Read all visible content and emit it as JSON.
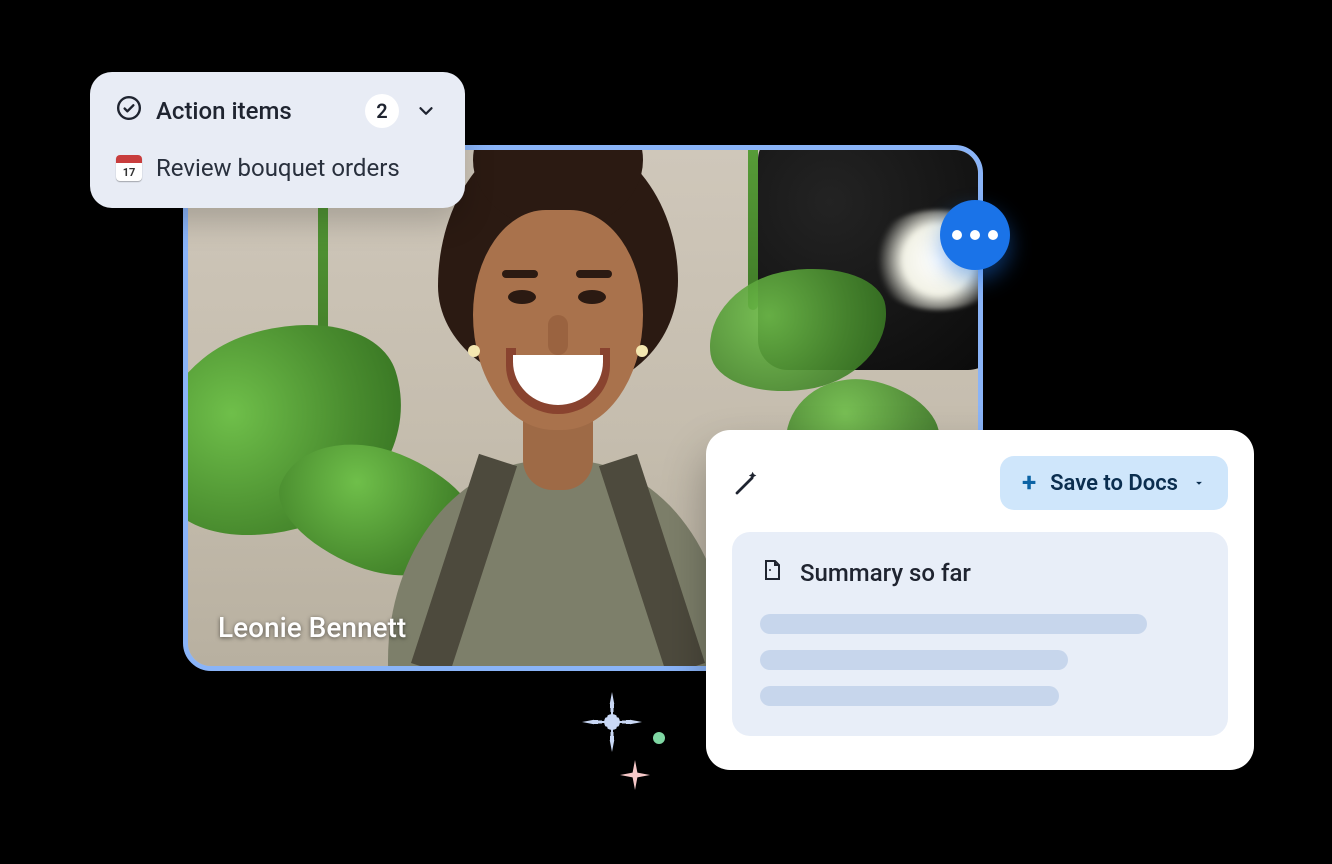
{
  "action_items": {
    "title": "Action items",
    "count": "2",
    "items": [
      {
        "label": "Review bouquet orders"
      }
    ]
  },
  "video": {
    "participant_name": "Leonie Bennett"
  },
  "summary": {
    "save_button_label": "Save to Docs",
    "section_title": "Summary so far"
  }
}
